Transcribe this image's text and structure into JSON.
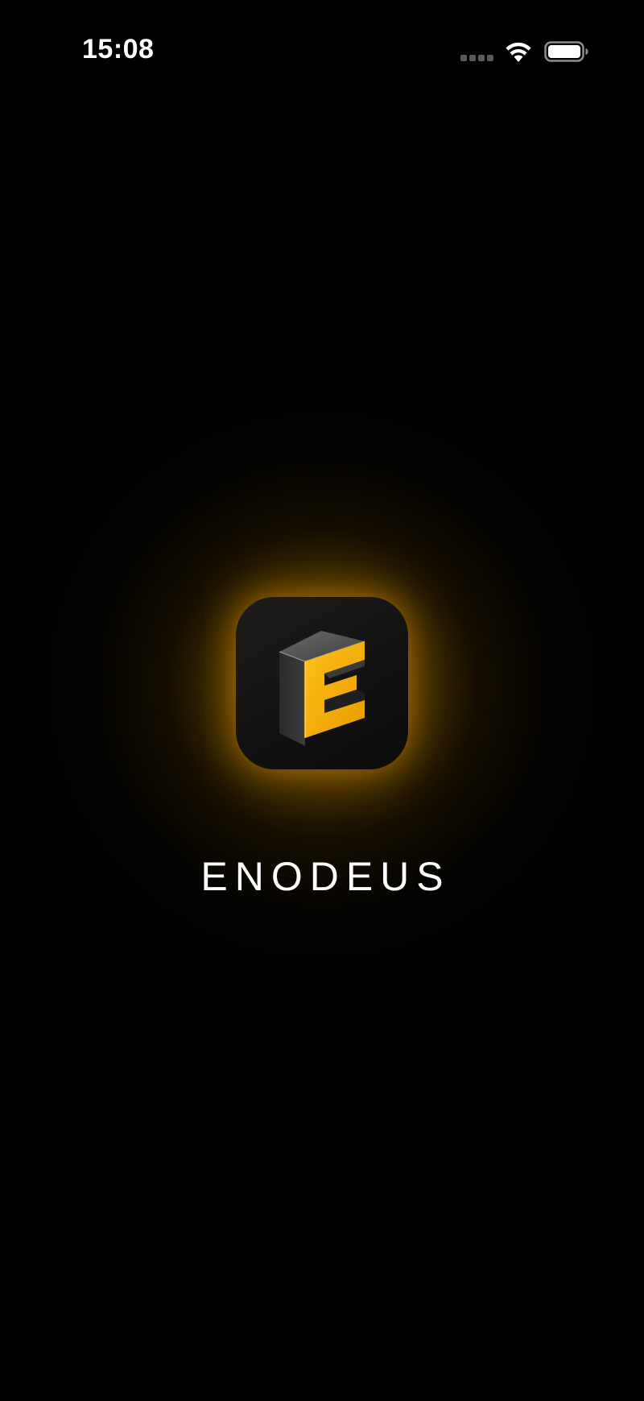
{
  "status_bar": {
    "time": "15:08",
    "signal_icon": "cellular-signal-icon",
    "wifi_icon": "wifi-icon",
    "battery_icon": "battery-icon"
  },
  "splash": {
    "app_icon": "enodeus-e-logo-icon",
    "app_name": "ENODEUS"
  },
  "colors": {
    "background": "#000000",
    "accent": "#F2A900",
    "glow": "#C8860A",
    "icon_background": "#141414",
    "text": "#FFFFFF"
  }
}
